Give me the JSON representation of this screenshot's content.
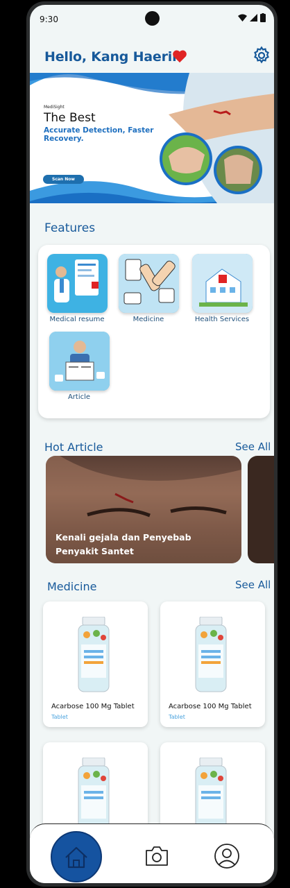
{
  "status": {
    "time": "9:30"
  },
  "header": {
    "greeting": "Hello, Kang Haerin"
  },
  "banner": {
    "brand": "MediSight",
    "title": "The Best",
    "subtitle": "Accurate Detection, Faster Recovery.",
    "button": "Scan Now"
  },
  "features": {
    "title": "Features",
    "items": [
      {
        "label": "Medical resume",
        "icon": "medical-resume-icon"
      },
      {
        "label": "Medicine",
        "icon": "medicine-icon"
      },
      {
        "label": "Health Services",
        "icon": "health-services-icon"
      },
      {
        "label": "Article",
        "icon": "article-icon"
      }
    ]
  },
  "hot_article": {
    "title": "Hot Article",
    "see_all": "See All",
    "items": [
      {
        "title": "Kenali gejala dan Penyebab Penyakit Santet"
      }
    ]
  },
  "medicine": {
    "title": "Medicine",
    "see_all": "See All",
    "items": [
      {
        "name": "Acarbose 100 Mg Tablet",
        "type": "Tablet"
      },
      {
        "name": "Acarbose 100 Mg Tablet",
        "type": "Tablet"
      },
      {
        "name": "",
        "type": ""
      },
      {
        "name": "",
        "type": ""
      }
    ]
  },
  "colors": {
    "primary": "#17599a",
    "accent": "#1553a0",
    "background": "#f1f6f6",
    "heart": "#e02424"
  }
}
